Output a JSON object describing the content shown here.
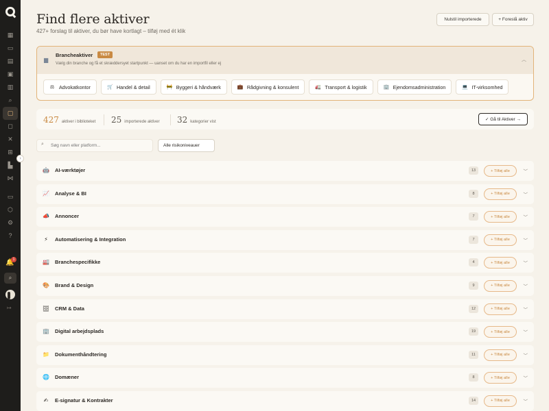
{
  "header": {
    "title": "Find flere aktiver",
    "subtitle": "427+ forslag til aktiver, du bør have kortlagt – tilføj med ét klik",
    "reset_label": "Nulstil importerede",
    "suggest_label": "+ Foreslå aktiv"
  },
  "branche": {
    "title": "Brancheaktiver",
    "badge": "TEST",
    "description": "Vælg din branche og få et skræddersyet startpunkt — uanset om du har en importfil eller ej",
    "chips": [
      {
        "label": "Advokatkontor",
        "icon": "⚖"
      },
      {
        "label": "Handel & detail",
        "icon": "🛒"
      },
      {
        "label": "Byggeri & håndværk",
        "icon": "🚧"
      },
      {
        "label": "Rådgivning & konsulent",
        "icon": "💼"
      },
      {
        "label": "Transport & logistik",
        "icon": "🚛"
      },
      {
        "label": "Ejendomsadministration",
        "icon": "🏢"
      },
      {
        "label": "IT-virksomhed",
        "icon": "💻"
      }
    ]
  },
  "stats": {
    "library_count": "427",
    "library_label": "aktiver i biblioteket",
    "imported_count": "25",
    "imported_label": "importerede aktiver",
    "categories_count": "32",
    "categories_label": "kategorier vist",
    "goto_label": "✓ Gå til Aktiver →"
  },
  "filters": {
    "search_placeholder": "Søg navn eller platform...",
    "risk_selected": "Alle risikoniveauer"
  },
  "add_all_label": "+ Tilføj alle",
  "categories": [
    {
      "name": "AI-værktøjer",
      "count": "13",
      "icon": "🤖"
    },
    {
      "name": "Analyse & BI",
      "count": "8",
      "icon": "📈"
    },
    {
      "name": "Annoncer",
      "count": "7",
      "icon": "📣"
    },
    {
      "name": "Automatisering & Integration",
      "count": "7",
      "icon": "⚡"
    },
    {
      "name": "Branchespecifikke",
      "count": "4",
      "icon": "🏭"
    },
    {
      "name": "Brand & Design",
      "count": "9",
      "icon": "🎨"
    },
    {
      "name": "CRM & Data",
      "count": "12",
      "icon": "🗄"
    },
    {
      "name": "Digital arbejdsplads",
      "count": "19",
      "icon": "🏢"
    },
    {
      "name": "Dokumenthåndtering",
      "count": "11",
      "icon": "📁"
    },
    {
      "name": "Domæner",
      "count": "8",
      "icon": "🌐"
    },
    {
      "name": "E-signatur & Kontrakter",
      "count": "14",
      "icon": "✍"
    }
  ],
  "colors": {
    "accent": "#c98a43",
    "sidebar": "#1e1d1b",
    "background": "#f6f2ea"
  },
  "sidebar": {
    "notification_count": "1"
  }
}
